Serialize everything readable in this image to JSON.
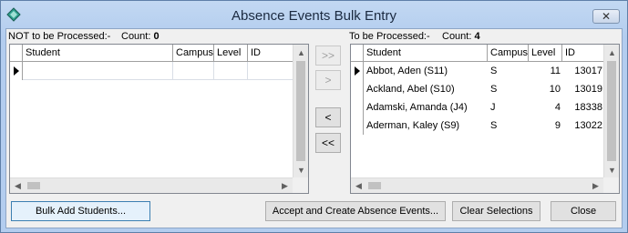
{
  "window": {
    "title": "Absence Events Bulk Entry",
    "close_glyph": "✕"
  },
  "left": {
    "caption": "NOT to be Processed:-",
    "count_label": "Count:",
    "count": "0",
    "columns": [
      "Student",
      "Campus",
      "Level",
      "ID"
    ],
    "rows": []
  },
  "right": {
    "caption": "To be Processed:-",
    "count_label": "Count:",
    "count": "4",
    "columns": [
      "Student",
      "Campus",
      "Level",
      "ID"
    ],
    "rows": [
      {
        "student": "Abbot, Aden (S11)",
        "campus": "S",
        "level": "11",
        "id": "13017"
      },
      {
        "student": "Ackland, Abel (S10)",
        "campus": "S",
        "level": "10",
        "id": "13019"
      },
      {
        "student": "Adamski, Amanda (J4)",
        "campus": "J",
        "level": "4",
        "id": "18338"
      },
      {
        "student": "Aderman, Kaley (S9)",
        "campus": "S",
        "level": "9",
        "id": "13022"
      }
    ]
  },
  "move_buttons": {
    "move_all_right": ">>",
    "move_right": ">",
    "move_left": "<",
    "move_all_left": "<<"
  },
  "buttons": {
    "bulk_add": "Bulk Add Students...",
    "accept": "Accept and Create Absence Events...",
    "clear": "Clear Selections",
    "close": "Close"
  },
  "icons": {
    "app": "diamond-app-icon",
    "up": "▲",
    "down": "▼",
    "left": "◀",
    "right": "▶"
  },
  "colors": {
    "title_bar": "#b3cdef",
    "default_button_border": "#3c7fb1"
  }
}
